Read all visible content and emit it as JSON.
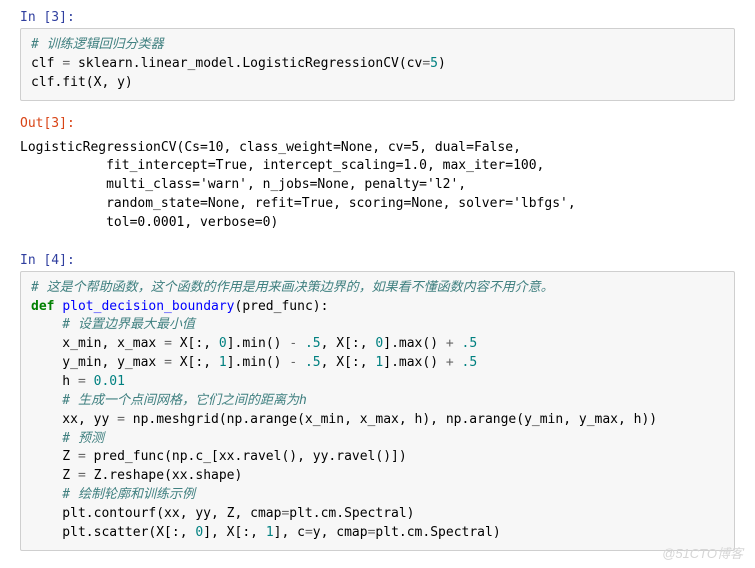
{
  "cells": {
    "in3": {
      "prompt": "In [3]:",
      "line1": "# 训练逻辑回归分类器",
      "line2_a": "clf ",
      "line2_op": "=",
      "line2_b": " sklearn.linear_model.LogisticRegressionCV(cv",
      "line2_op2": "=",
      "line2_num": "5",
      "line2_c": ")",
      "line3": "clf.fit(X, y)"
    },
    "out3": {
      "prompt": "Out[3]:",
      "text": "LogisticRegressionCV(Cs=10, class_weight=None, cv=5, dual=False,\n           fit_intercept=True, intercept_scaling=1.0, max_iter=100,\n           multi_class='warn', n_jobs=None, penalty='l2',\n           random_state=None, refit=True, scoring=None, solver='lbfgs',\n           tol=0.0001, verbose=0)"
    },
    "in4": {
      "prompt": "In [4]:",
      "c1": "# 这是个帮助函数，这个函数的作用是用来画决策边界的，如果看不懂函数内容不用介意。",
      "kw_def": "def",
      "sp1": " ",
      "fn": "plot_decision_boundary",
      "sig": "(pred_func):",
      "c2": "    # 设置边界最大最小值",
      "l3a": "    x_min, x_max ",
      "eq": "=",
      "l3b": " X[:, ",
      "n0": "0",
      "l3c": "].min() ",
      "minus": "-",
      "l3d": " ",
      "np5": ".5",
      "l3e": ", X[:, ",
      "l3f": "].max() ",
      "plus": "+",
      "l4a": "    y_min, y_max ",
      "l4b": " X[:, ",
      "n1": "1",
      "l5a": "    h ",
      "n001": "0.01",
      "c3": "    # 生成一个点间网格，它们之间的距离为h",
      "l7": "    xx, yy ",
      "l7b": " np.meshgrid(np.arange(x_min, x_max, h), np.arange(y_min, y_max, h))",
      "c4": "    # 预测",
      "l9a": "    Z ",
      "l9b": " pred_func(np.c_[xx.ravel(), yy.ravel()])",
      "l10a": "    Z ",
      "l10b": " Z.reshape(xx.shape)",
      "c5": "    # 绘制轮廓和训练示例",
      "l12": "    plt.contourf(xx, yy, Z, cmap",
      "l12b": "plt.cm.Spectral)",
      "l13": "    plt.scatter(X[:, ",
      "l13b": "], X[:, ",
      "l13c": "], c",
      "l13d": "y, cmap",
      "l13e": "plt.cm.Spectral)"
    }
  },
  "watermark": "@51CTO博客"
}
